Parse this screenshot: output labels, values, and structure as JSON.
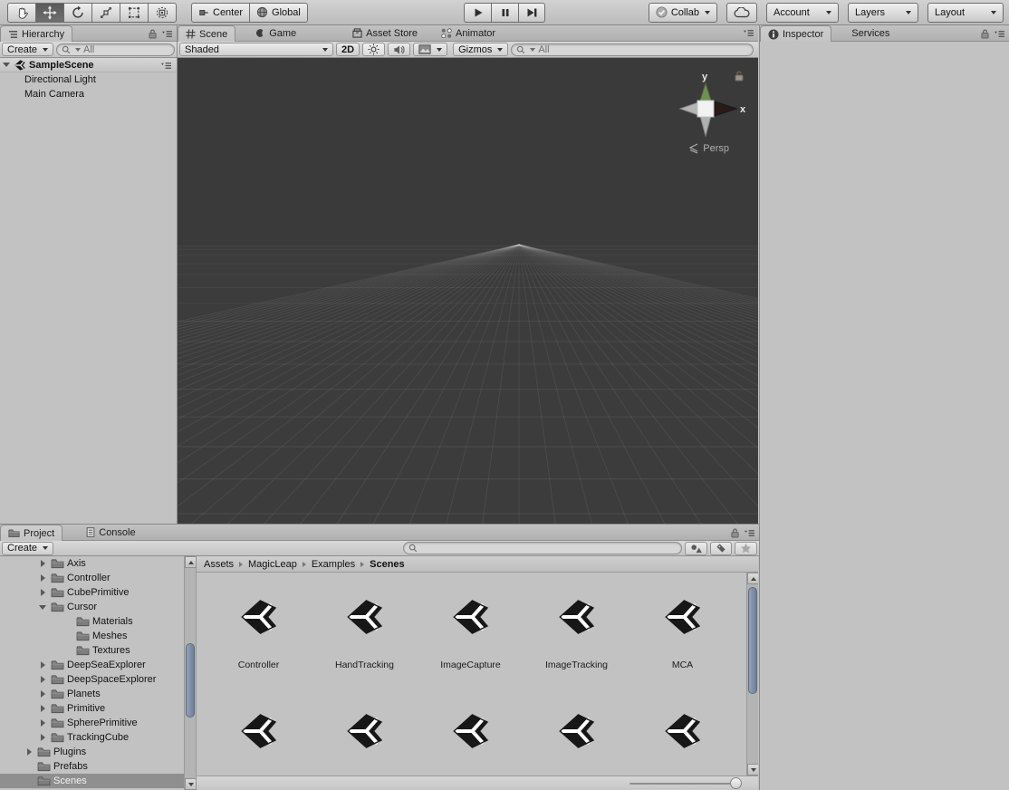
{
  "toolbar": {
    "tools": [
      {
        "name": "hand-tool",
        "active": false
      },
      {
        "name": "move-tool",
        "active": true
      },
      {
        "name": "rotate-tool",
        "active": false
      },
      {
        "name": "scale-tool",
        "active": false
      },
      {
        "name": "rect-tool",
        "active": false
      },
      {
        "name": "transform-tool",
        "active": false
      }
    ],
    "pivot_label": "Center",
    "space_label": "Global",
    "collab_label": "Collab",
    "account_label": "Account",
    "layers_label": "Layers",
    "layout_label": "Layout",
    "icons": [
      "collab-check-icon",
      "cloud-icon",
      "play-icon",
      "pause-icon",
      "step-icon"
    ]
  },
  "hierarchy": {
    "tab_label": "Hierarchy",
    "create_label": "Create",
    "search_placeholder": "All",
    "scene_name": "SampleScene",
    "items": [
      "Directional Light",
      "Main Camera"
    ]
  },
  "scene_view": {
    "tabs": [
      "Scene",
      "Game",
      "Asset Store",
      "Animator"
    ],
    "shading_mode": "Shaded",
    "toggle_2d_label": "2D",
    "gizmos_label": "Gizmos",
    "search_placeholder": "All",
    "axis_y_label": "y",
    "axis_x_label": "x",
    "persp_label": "Persp",
    "colors": {
      "viewport_bg": "#3c3c3c",
      "axis_y": "#6f8f57",
      "axis_x": "#2a1a16",
      "axis_neutral": "#b5b5b5"
    }
  },
  "inspector": {
    "tabs": [
      "Inspector",
      "Services"
    ]
  },
  "project": {
    "tabs": [
      "Project",
      "Console"
    ],
    "create_label": "Create",
    "breadcrumb": [
      "Assets",
      "MagicLeap",
      "Examples",
      "Scenes"
    ],
    "tree": [
      {
        "label": "Axis",
        "level": 2,
        "arrow": "collapsed"
      },
      {
        "label": "Controller",
        "level": 2,
        "arrow": "collapsed"
      },
      {
        "label": "CubePrimitive",
        "level": 2,
        "arrow": "collapsed"
      },
      {
        "label": "Cursor",
        "level": 2,
        "arrow": "expanded"
      },
      {
        "label": "Materials",
        "level": 3,
        "arrow": "none"
      },
      {
        "label": "Meshes",
        "level": 3,
        "arrow": "none"
      },
      {
        "label": "Textures",
        "level": 3,
        "arrow": "none"
      },
      {
        "label": "DeepSeaExplorer",
        "level": 2,
        "arrow": "collapsed"
      },
      {
        "label": "DeepSpaceExplorer",
        "level": 2,
        "arrow": "collapsed"
      },
      {
        "label": "Planets",
        "level": 2,
        "arrow": "collapsed"
      },
      {
        "label": "Primitive",
        "level": 2,
        "arrow": "collapsed"
      },
      {
        "label": "SpherePrimitive",
        "level": 2,
        "arrow": "collapsed"
      },
      {
        "label": "TrackingCube",
        "level": 2,
        "arrow": "collapsed"
      },
      {
        "label": "Plugins",
        "level": 1,
        "arrow": "collapsed"
      },
      {
        "label": "Prefabs",
        "level": 1,
        "arrow": "none"
      },
      {
        "label": "Scenes",
        "level": 1,
        "arrow": "none",
        "selected": true
      }
    ],
    "assets_row1": [
      "Controller",
      "HandTracking",
      "ImageCapture",
      "ImageTracking",
      "MCA"
    ],
    "assets_row2_count": 5,
    "asset_icon": "unity-scene-icon"
  }
}
